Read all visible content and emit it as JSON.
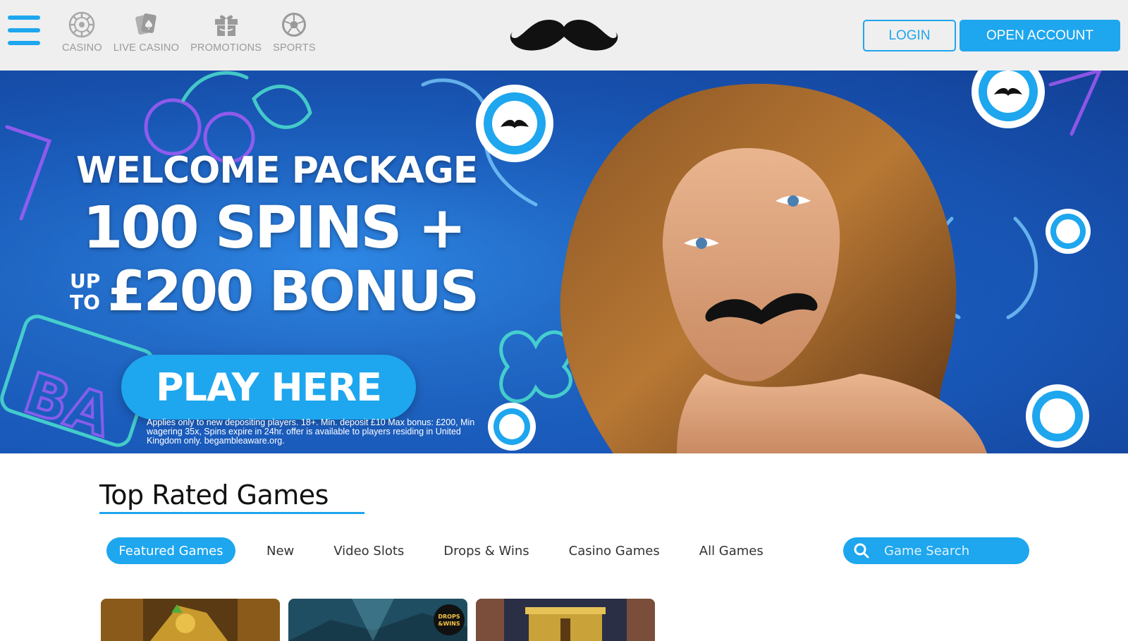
{
  "header": {
    "nav": [
      {
        "label": "CASINO",
        "icon": "casino-chip-icon"
      },
      {
        "label": "LIVE CASINO",
        "icon": "cards-icon"
      },
      {
        "label": "PROMOTIONS",
        "icon": "gift-icon"
      },
      {
        "label": "SPORTS",
        "icon": "football-icon"
      }
    ],
    "logo_icon": "mustache-logo",
    "login_label": "LOGIN",
    "open_account_label": "OPEN ACCOUNT"
  },
  "hero": {
    "line1": "WELCOME PACKAGE",
    "line2": "100 SPINS +",
    "up": "UP",
    "to": "TO",
    "line3": "£200 BONUS",
    "cta_label": "PLAY HERE",
    "terms": "Applies only to new depositing players. 18+. Min. deposit £10 Max bonus: £200, Min wagering 35x, Spins expire in 24hr. offer is available to players residing in United Kingdom only. begambleaware.org."
  },
  "games": {
    "title": "Top Rated Games",
    "tabs": [
      "Featured Games",
      "New",
      "Video Slots",
      "Drops & Wins",
      "Casino Games",
      "All Games"
    ],
    "active_tab": "Featured Games",
    "search_placeholder": "Game Search",
    "thumb_badge_top": "DROPS",
    "thumb_badge_bottom": "&WINS"
  },
  "colors": {
    "accent": "#1ea6ee",
    "header_bg": "#efefef",
    "hero_bg": "#1b5fc2"
  }
}
